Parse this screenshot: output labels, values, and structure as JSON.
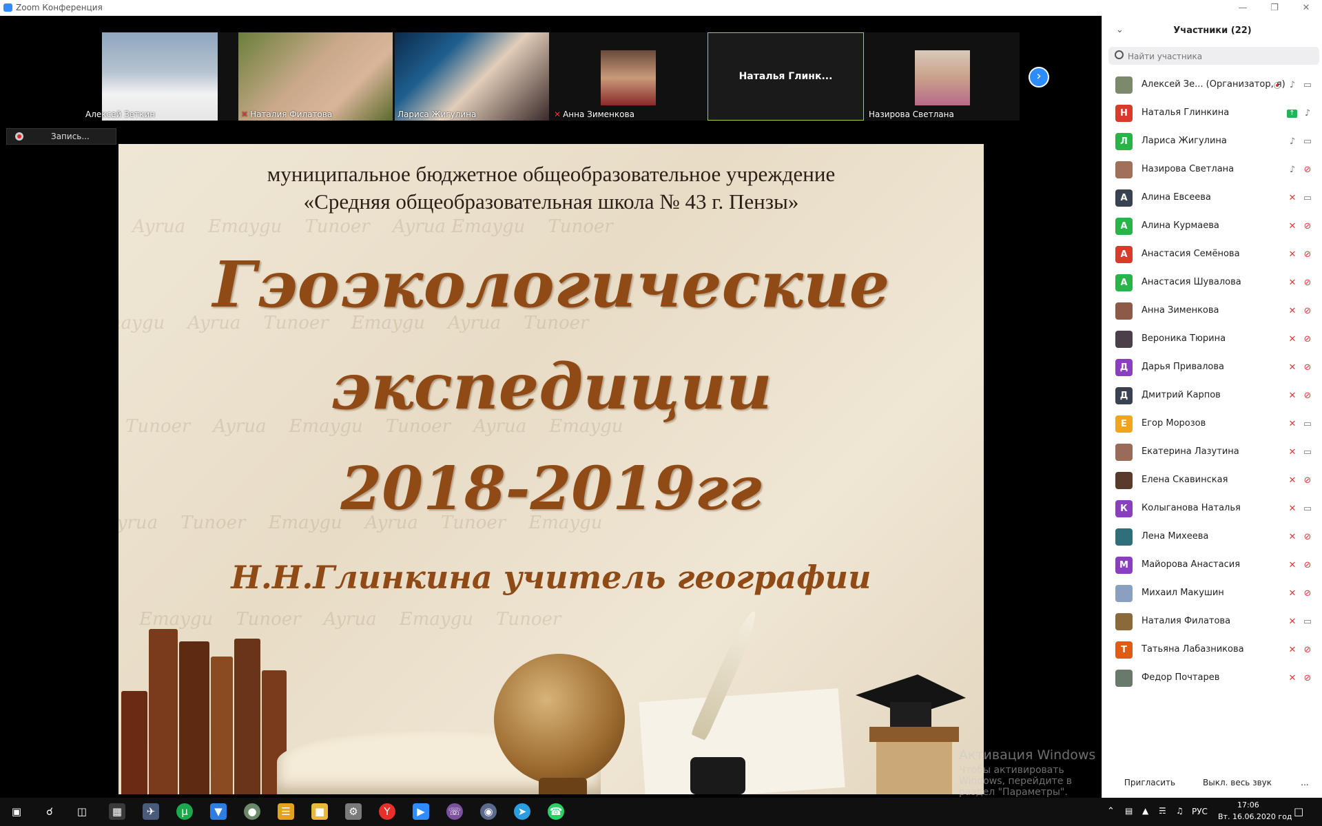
{
  "window": {
    "title": "Zoom Конференция"
  },
  "gallery": {
    "tiles": [
      {
        "name": "Алексей Зеткин",
        "muted": false
      },
      {
        "name": "Наталия Филатова",
        "muted": true
      },
      {
        "name": "Лариса Жигулина",
        "muted": false
      },
      {
        "name": "Анна Зименкова",
        "muted": true
      },
      {
        "name": "Наталья Глинк...",
        "muted": false
      },
      {
        "name": "Назирова Светлана",
        "muted": false
      }
    ]
  },
  "recording": {
    "label": "Запись..."
  },
  "slide": {
    "org_line1": "муниципальное бюджетное общеобразовательное учреждение",
    "org_line2": "«Средняя общеобразовательная школа № 43 г. Пензы»",
    "title_line1": "Гэоэкологические",
    "title_line2": "экспедиции",
    "years": "2018-2019гг",
    "author": "Н.Н.Глинкина  учитель географии"
  },
  "watermark": {
    "line1": "Активация Windows",
    "line2": "Чтобы активировать Windows, перейдите в раздел \"Параметры\"."
  },
  "participants_panel": {
    "title": "Участники (22)",
    "search_placeholder": "Найти участника",
    "participants": [
      {
        "name": "Алексей Зе... (Организатор, я)",
        "initial": "",
        "avatar_color": "#7a8a6a",
        "mic": "on",
        "cam": "on",
        "host": true
      },
      {
        "name": "Наталья Глинкина",
        "initial": "Н",
        "avatar_color": "#d93a2b",
        "mic": "on",
        "cam": "share"
      },
      {
        "name": "Лариса Жигулина",
        "initial": "Л",
        "avatar_color": "#27b54a",
        "mic": "on",
        "cam": "on"
      },
      {
        "name": "Назирова Светлана",
        "initial": "",
        "avatar_color": "#a0705a",
        "mic": "on",
        "cam": "off"
      },
      {
        "name": "Алина Евсеева",
        "initial": "А",
        "avatar_color": "#3a4150",
        "mic": "off",
        "cam": "on"
      },
      {
        "name": "Алина Курмаева",
        "initial": "А",
        "avatar_color": "#27b54a",
        "mic": "off",
        "cam": "off"
      },
      {
        "name": "Анастасия Семёнова",
        "initial": "А",
        "avatar_color": "#d93a2b",
        "mic": "off",
        "cam": "off"
      },
      {
        "name": "Анастасия Шувалова",
        "initial": "А",
        "avatar_color": "#27b54a",
        "mic": "off",
        "cam": "off"
      },
      {
        "name": "Анна Зименкова",
        "initial": "",
        "avatar_color": "#8c5a46",
        "mic": "off",
        "cam": "off"
      },
      {
        "name": "Вероника Тюрина",
        "initial": "",
        "avatar_color": "#4a4048",
        "mic": "off",
        "cam": "off"
      },
      {
        "name": "Дарья Привалова",
        "initial": "Д",
        "avatar_color": "#8a3fc1",
        "mic": "off",
        "cam": "off"
      },
      {
        "name": "Дмитрий Карпов",
        "initial": "Д",
        "avatar_color": "#3a4150",
        "mic": "off",
        "cam": "off"
      },
      {
        "name": "Егор Морозов",
        "initial": "Е",
        "avatar_color": "#f2a51c",
        "mic": "off",
        "cam": "on"
      },
      {
        "name": "Екатерина Лазутина",
        "initial": "",
        "avatar_color": "#9a6a5a",
        "mic": "off",
        "cam": "on"
      },
      {
        "name": "Елена Скавинская",
        "initial": "",
        "avatar_color": "#5a3a2a",
        "mic": "off",
        "cam": "off"
      },
      {
        "name": "Колыганова Наталья",
        "initial": "К",
        "avatar_color": "#8a3fc1",
        "mic": "off",
        "cam": "on"
      },
      {
        "name": "Лена Михеева",
        "initial": "",
        "avatar_color": "#2f6f7a",
        "mic": "off",
        "cam": "off"
      },
      {
        "name": "Майорова Анастасия",
        "initial": "М",
        "avatar_color": "#8a3fc1",
        "mic": "off",
        "cam": "off"
      },
      {
        "name": "Михаил Макушин",
        "initial": "",
        "avatar_color": "#8aa0c0",
        "mic": "off",
        "cam": "off"
      },
      {
        "name": "Наталия Филатова",
        "initial": "",
        "avatar_color": "#8a6a3a",
        "mic": "off",
        "cam": "on"
      },
      {
        "name": "Татьяна Лабазникова",
        "initial": "Т",
        "avatar_color": "#e25b12",
        "mic": "off",
        "cam": "off"
      },
      {
        "name": "Федор Почтарев",
        "initial": "",
        "avatar_color": "#6a7a6a",
        "mic": "off",
        "cam": "off"
      }
    ],
    "invite_label": "Пригласить",
    "mute_all_label": "Выкл. весь звук",
    "more_label": "..."
  },
  "taskbar": {
    "language": "РУС",
    "time": "17:06",
    "date": "Вт. 16.06.2020 год"
  }
}
